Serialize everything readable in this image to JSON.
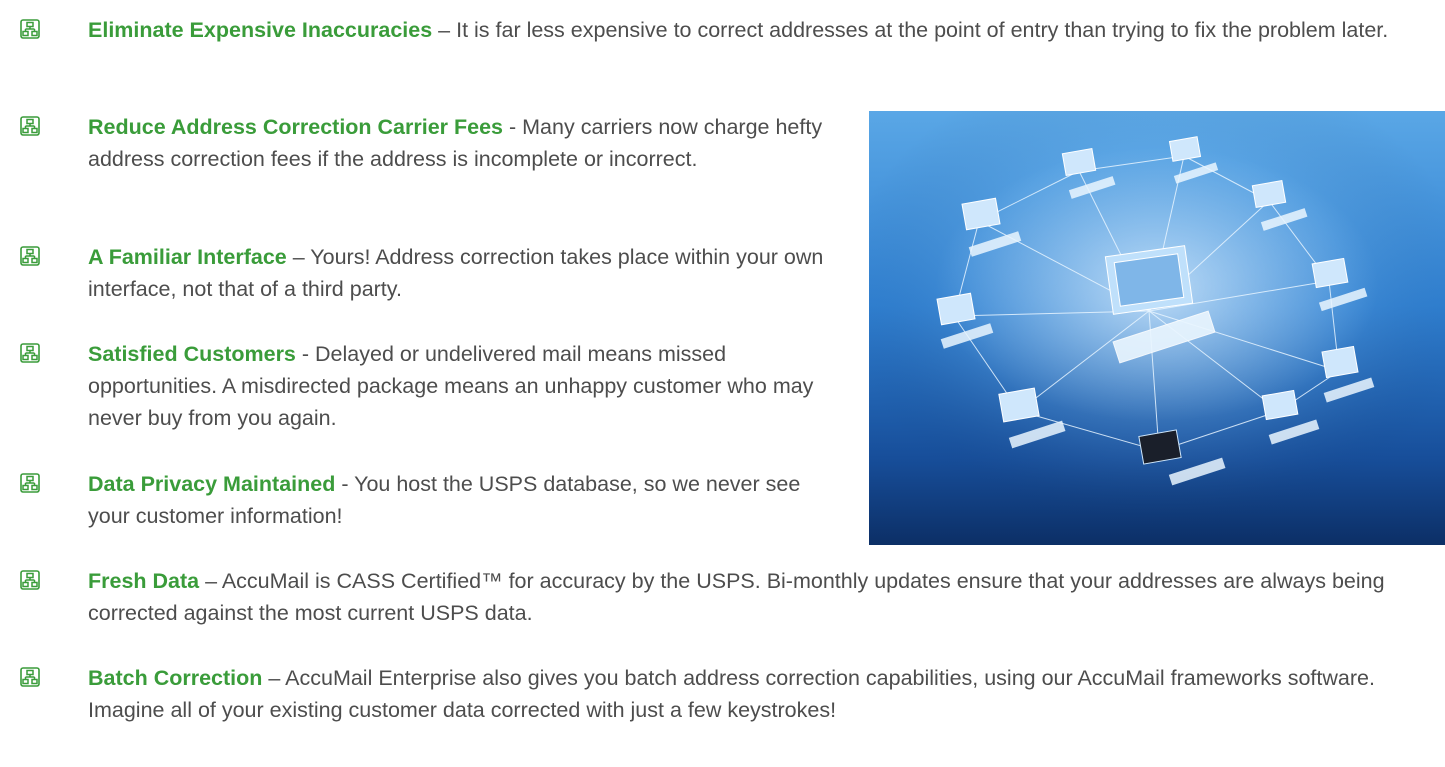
{
  "benefits": [
    {
      "title": "Eliminate Expensive Inaccuracies",
      "sep": " – ",
      "body": "It is far less expensive to correct addresses at the point of entry than trying to fix the problem later."
    },
    {
      "title": "Reduce Address Correction Carrier Fees",
      "sep": " - ",
      "body": "Many carriers now charge hefty address correction fees if the address is incomplete or incorrect."
    },
    {
      "title": "A Familiar Interface",
      "sep": " – ",
      "body": "Yours! Address correction takes place within your own interface, not that of a third party."
    },
    {
      "title": "Satisfied Customers",
      "sep": " - ",
      "body": "Delayed or undelivered mail means missed opportunities. A misdirected package means an unhappy customer who may never buy from you again."
    },
    {
      "title": "Data Privacy Maintained",
      "sep": " - ",
      "body": "You host the USPS database, so we never see your customer information!"
    },
    {
      "title": "Fresh Data",
      "sep": " – ",
      "body": "AccuMail is CASS Certified™ for accuracy by the USPS. Bi-monthly updates ensure that your addresses are always being corrected against the most current USPS data."
    },
    {
      "title": "Batch Correction",
      "sep": " – ",
      "body": "AccuMail Enterprise also gives you batch address correction capabilities, using our AccuMail frameworks software. Imagine all of your existing customer data corrected with just a few keystrokes!"
    }
  ],
  "colors": {
    "heading": "#3a9c3a",
    "body_text": "#4d4d4d",
    "bullet": "#3a9c3a"
  },
  "icons": {
    "bullet": "network-icon",
    "photo": "network-of-computers-image"
  }
}
